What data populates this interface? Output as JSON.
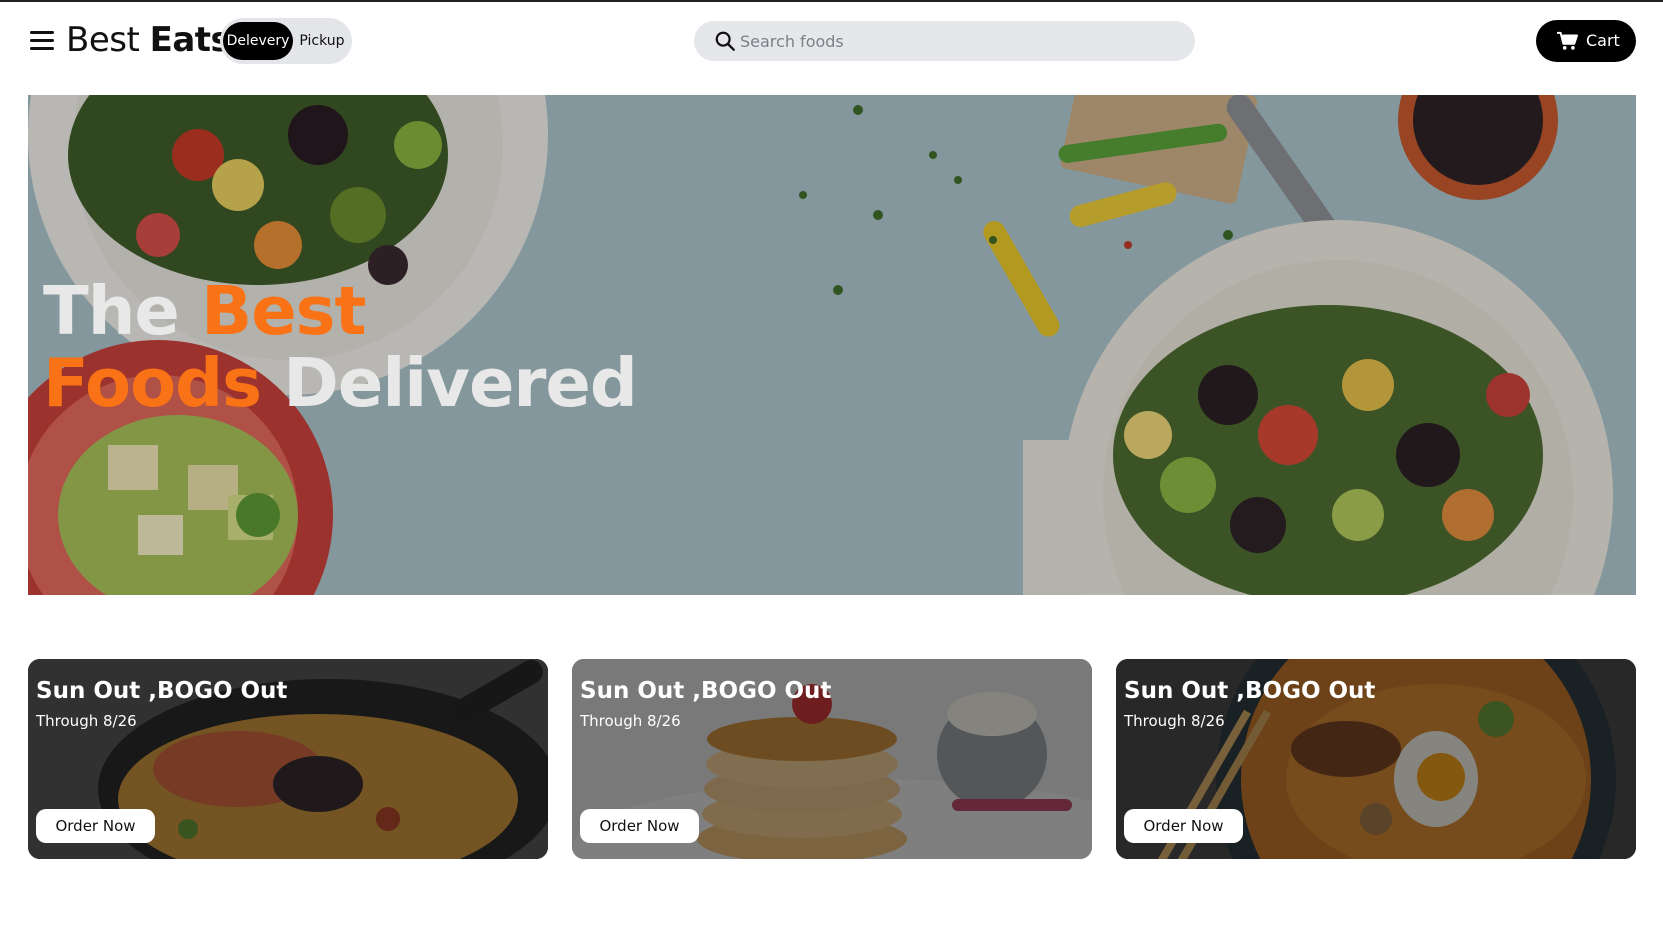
{
  "navbar": {
    "logo_first": "Best",
    "logo_second": "Eats",
    "toggle": {
      "active": "Delevery",
      "inactive": "Pickup"
    },
    "search": {
      "placeholder": "Search foods",
      "value": ""
    },
    "cart_label": "Cart"
  },
  "hero": {
    "title_line1_a": "The",
    "title_line1_b": "Best",
    "title_line2_a": "Foods",
    "title_line2_b": "Delivered",
    "accent_color": "#f97316"
  },
  "cards": [
    {
      "title": "Sun Out ,BOGO Out",
      "subtitle": "Through 8/26",
      "button": "Order Now",
      "image": "paella-shrimp"
    },
    {
      "title": "Sun Out ,BOGO Out",
      "subtitle": "Through 8/26",
      "button": "Order Now",
      "image": "pancakes"
    },
    {
      "title": "Sun Out ,BOGO Out",
      "subtitle": "Through 8/26",
      "button": "Order Now",
      "image": "ramen-bowl"
    }
  ]
}
